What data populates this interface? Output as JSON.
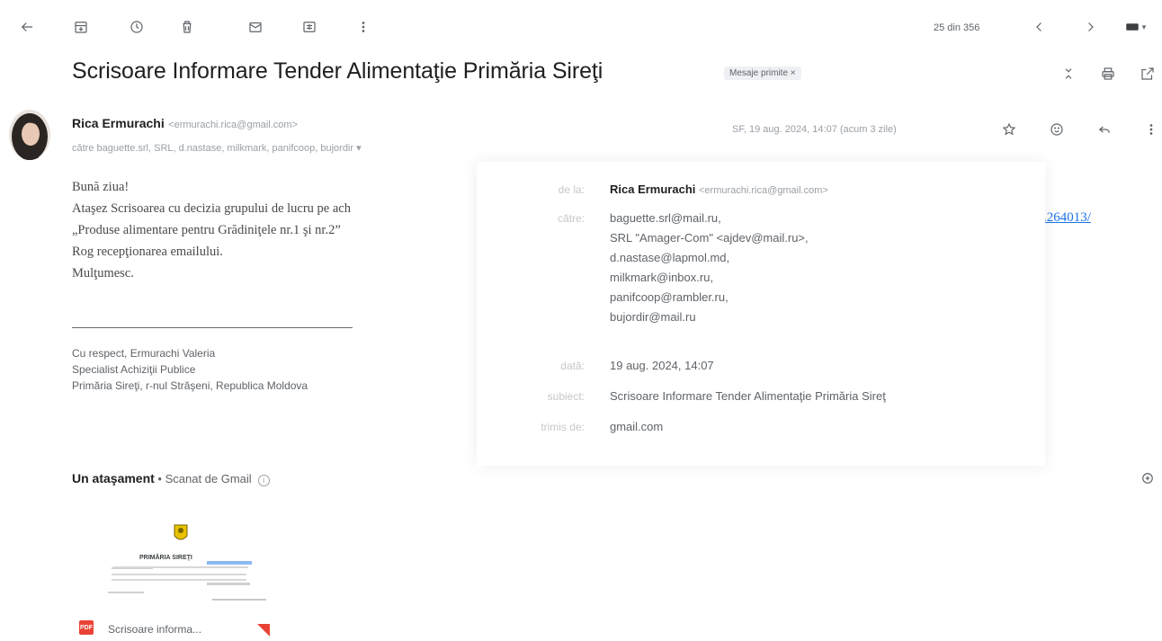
{
  "toolbar": {
    "back_icon": "arrow-left-icon",
    "archive_icon": "archive-icon",
    "snooze_icon": "clock-icon",
    "delete_icon": "trash-icon",
    "mark_unread_icon": "mail-icon",
    "move_icon": "label-icon",
    "more_icon": "more-vert-icon",
    "count": "25 din 356",
    "prev_icon": "chevron-left-icon",
    "next_icon": "chevron-right-icon",
    "keyboard_icon": "keyboard-icon"
  },
  "email": {
    "subject": "Scrisoare Informare Tender Alimentaţie Primăria Sireţi",
    "label_chip": "Mesaje primite ×",
    "sender": {
      "name": "Rica Ermurachi",
      "email": "<ermurachi.rica@gmail.com>"
    },
    "recipients_line": "către baguette.srl, SRL, d.nastase, milkmark, panifcoop, bujordir ▾",
    "date_line": "SF, 19 aug. 2024, 14:07 (acum 3 zile)",
    "body_lines": [
      "Bună ziua!",
      "Ataşez Scrisoarea cu decizia grupului de lucru pe ach",
      "„Produse alimentare pentru Grădiniţele nr.1 şi nr.2”",
      "Rog recepţionarea emailului.",
      "Mulţumesc."
    ],
    "body_link": ".264013/",
    "signature": [
      "Cu respect, Ermurachi Valeria",
      "Specialist Achiziţii Publice",
      "Primăria Sireţi, r-nul Străşeni,  Republica Moldova"
    ]
  },
  "details_popup": {
    "labels": {
      "from": "de la:",
      "to": "către:",
      "date": "dată:",
      "subject": "subiect:",
      "mailed_by": "trimis de:"
    },
    "from_name": "Rica Ermurachi",
    "from_email": "<ermurachi.rica@gmail.com>",
    "to_list": [
      "baguette.srl@mail.ru,",
      "SRL \"Amager-Com\" <ajdev@mail.ru>,",
      "d.nastase@lapmol.md,",
      "milkmark@inbox.ru,",
      "panifcoop@rambler.ru,",
      "bujordir@mail.ru"
    ],
    "date": "19 aug. 2024, 14:07",
    "subject": "Scrisoare Informare Tender Alimentaţie Primăria Sireţ",
    "mailed_by": "gmail.com"
  },
  "attachments": {
    "title_bold": "Un ataşament",
    "title_rest": " •  Scanat de Gmail",
    "file_name": "Scrisoare informa...",
    "thumb_header": "PRIMĂRIA SIREŢI"
  },
  "colors": {
    "accent_link": "#1a73e8",
    "pdf_red": "#ea4335",
    "text_dark": "#1f1f1f",
    "text_muted": "#5f6368"
  }
}
